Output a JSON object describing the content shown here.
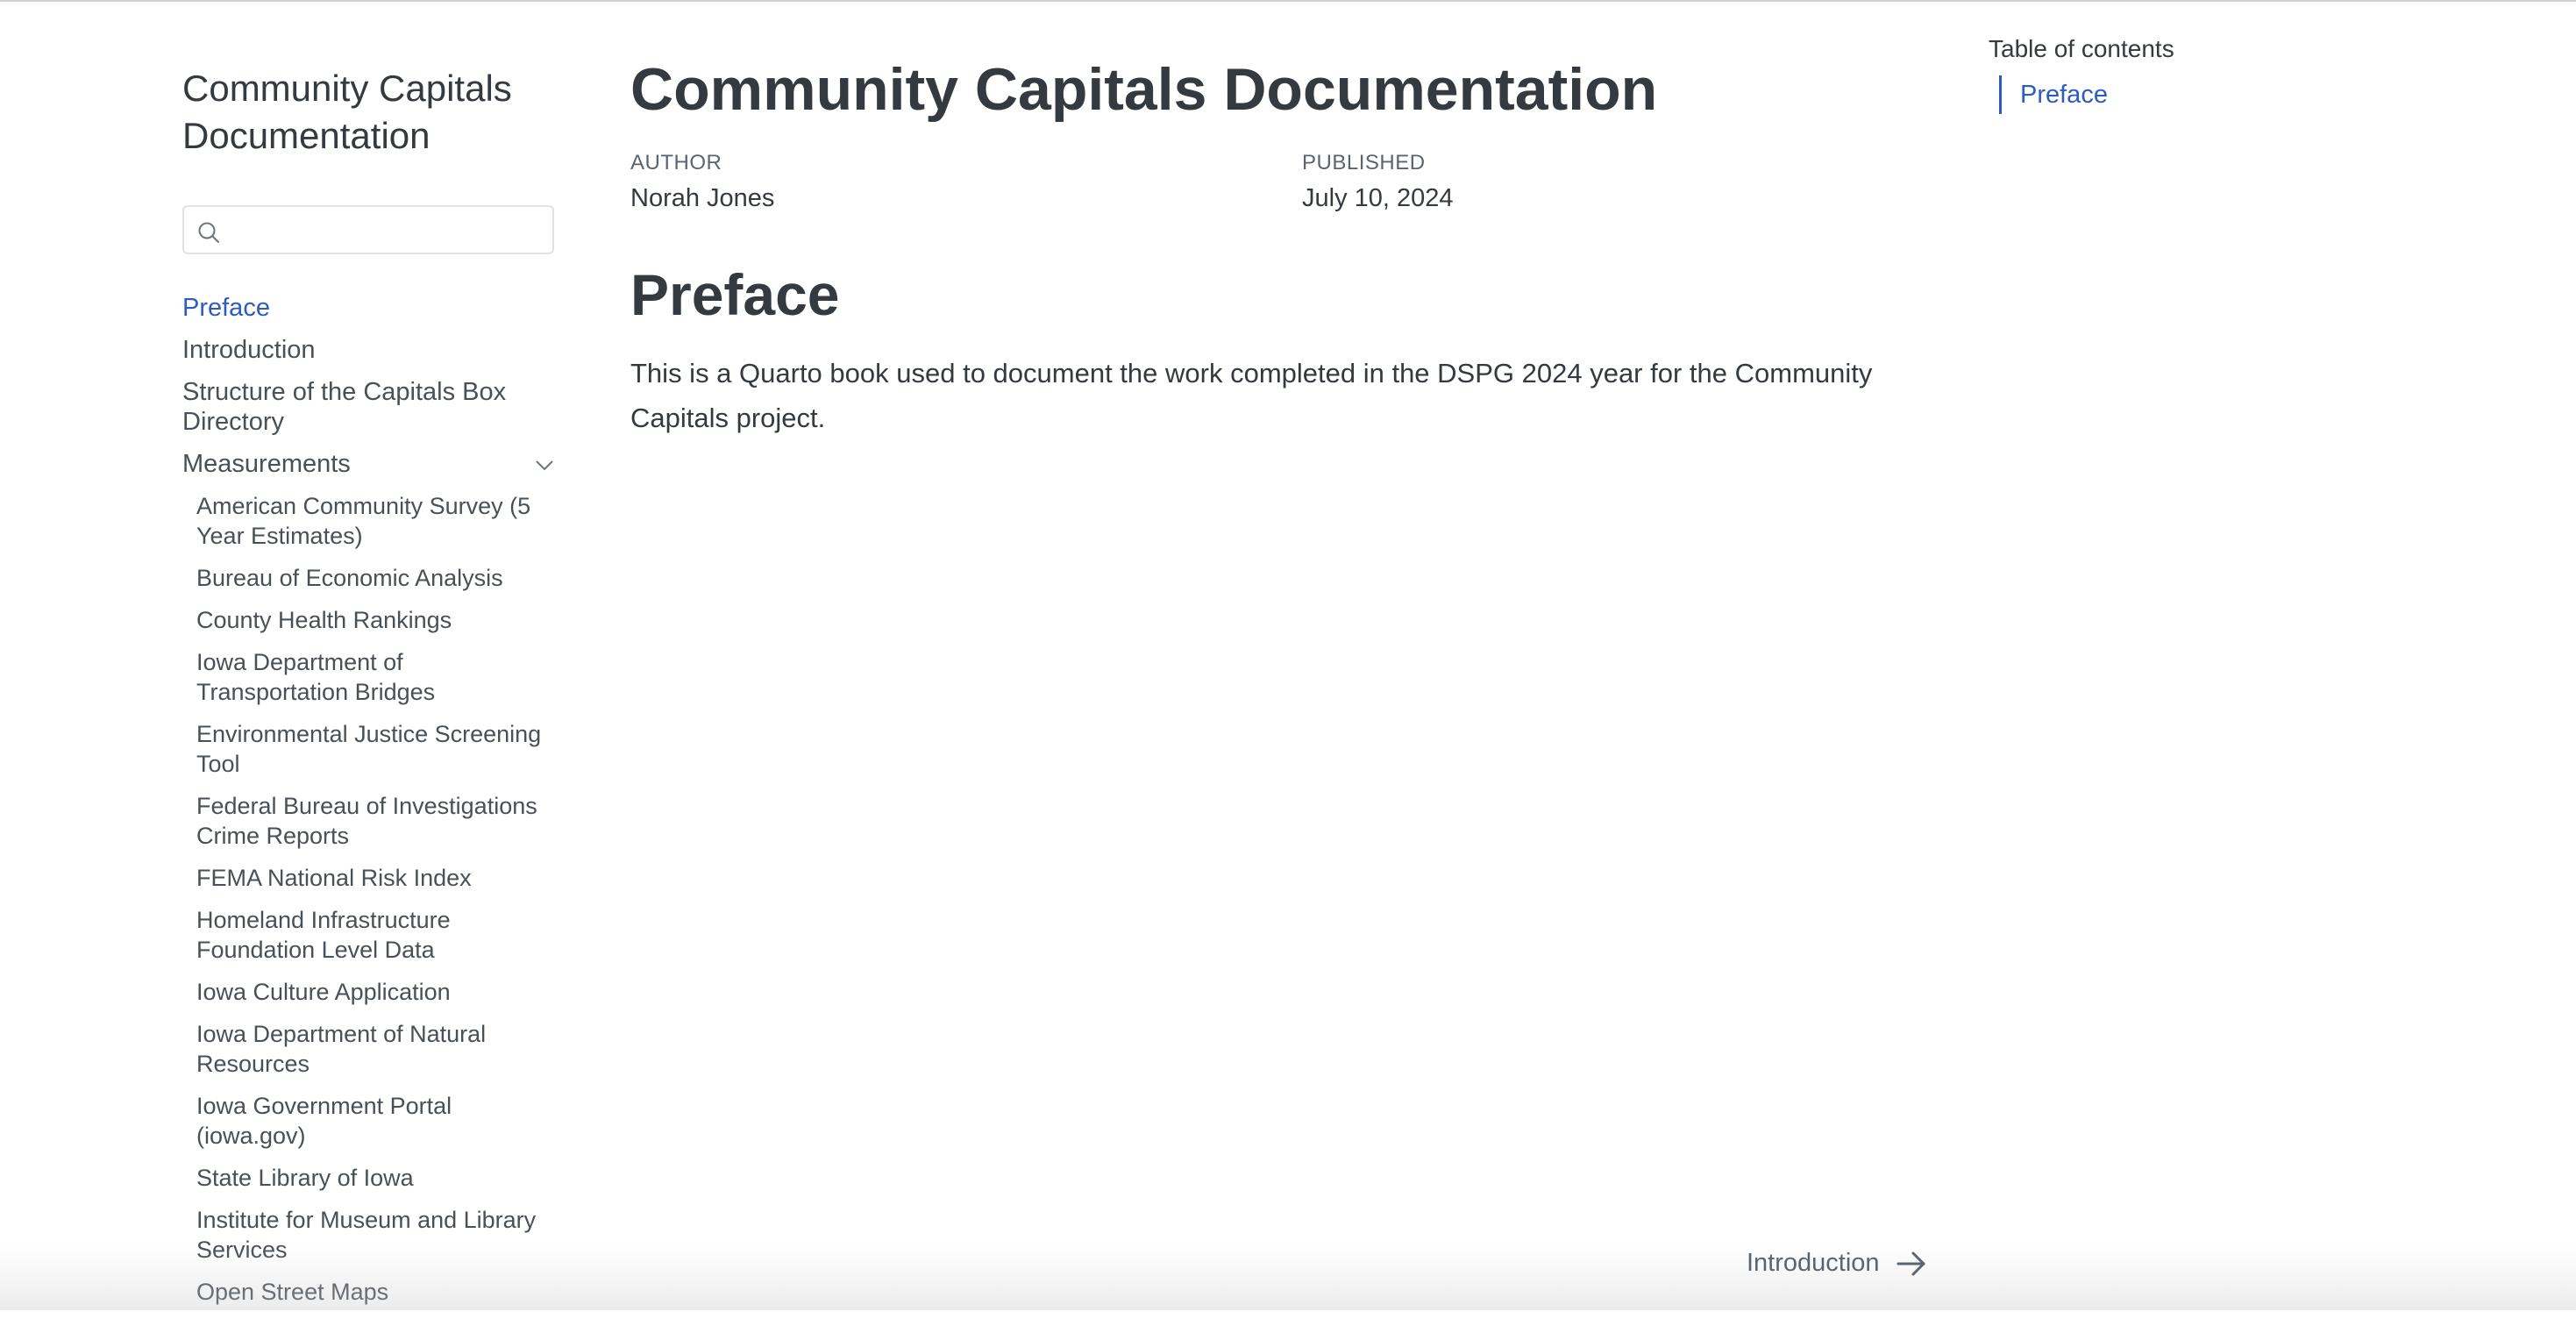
{
  "sidebar": {
    "title": "Community Capitals Documentation",
    "search": {
      "value": "",
      "placeholder": ""
    },
    "items": [
      {
        "label": "Preface"
      },
      {
        "label": "Introduction"
      },
      {
        "label": "Structure of the Capitals Box Directory"
      }
    ],
    "measurements": {
      "label": "Measurements",
      "items": [
        {
          "label": "American Community Survey (5 Year Estimates)"
        },
        {
          "label": "Bureau of Economic Analysis"
        },
        {
          "label": "County Health Rankings"
        },
        {
          "label": "Iowa Department of Transportation Bridges"
        },
        {
          "label": "Environmental Justice Screening Tool"
        },
        {
          "label": "Federal Bureau of Investigations Crime Reports"
        },
        {
          "label": "FEMA National Risk Index"
        },
        {
          "label": "Homeland Infrastructure Foundation Level Data"
        },
        {
          "label": "Iowa Culture Application"
        },
        {
          "label": "Iowa Department of Natural Resources"
        },
        {
          "label": "Iowa Government Portal (iowa.gov)"
        },
        {
          "label": "State Library of Iowa"
        },
        {
          "label": "Institute for Museum and Library Services"
        },
        {
          "label": "Open Street Maps"
        }
      ]
    }
  },
  "main": {
    "title": "Community Capitals Documentation",
    "author_label": "AUTHOR",
    "author": "Norah Jones",
    "published_label": "PUBLISHED",
    "published": "July 10, 2024",
    "section_heading": "Preface",
    "paragraph": "This is a Quarto book used to document the work completed in the DSPG 2024 year for the Community Capitals project."
  },
  "toc": {
    "title": "Table of contents",
    "items": [
      {
        "label": "Preface"
      }
    ]
  },
  "next_nav": {
    "label": "Introduction"
  },
  "colors": {
    "accent": "#2d5bbf",
    "text": "#343a40",
    "muted": "#495057"
  }
}
